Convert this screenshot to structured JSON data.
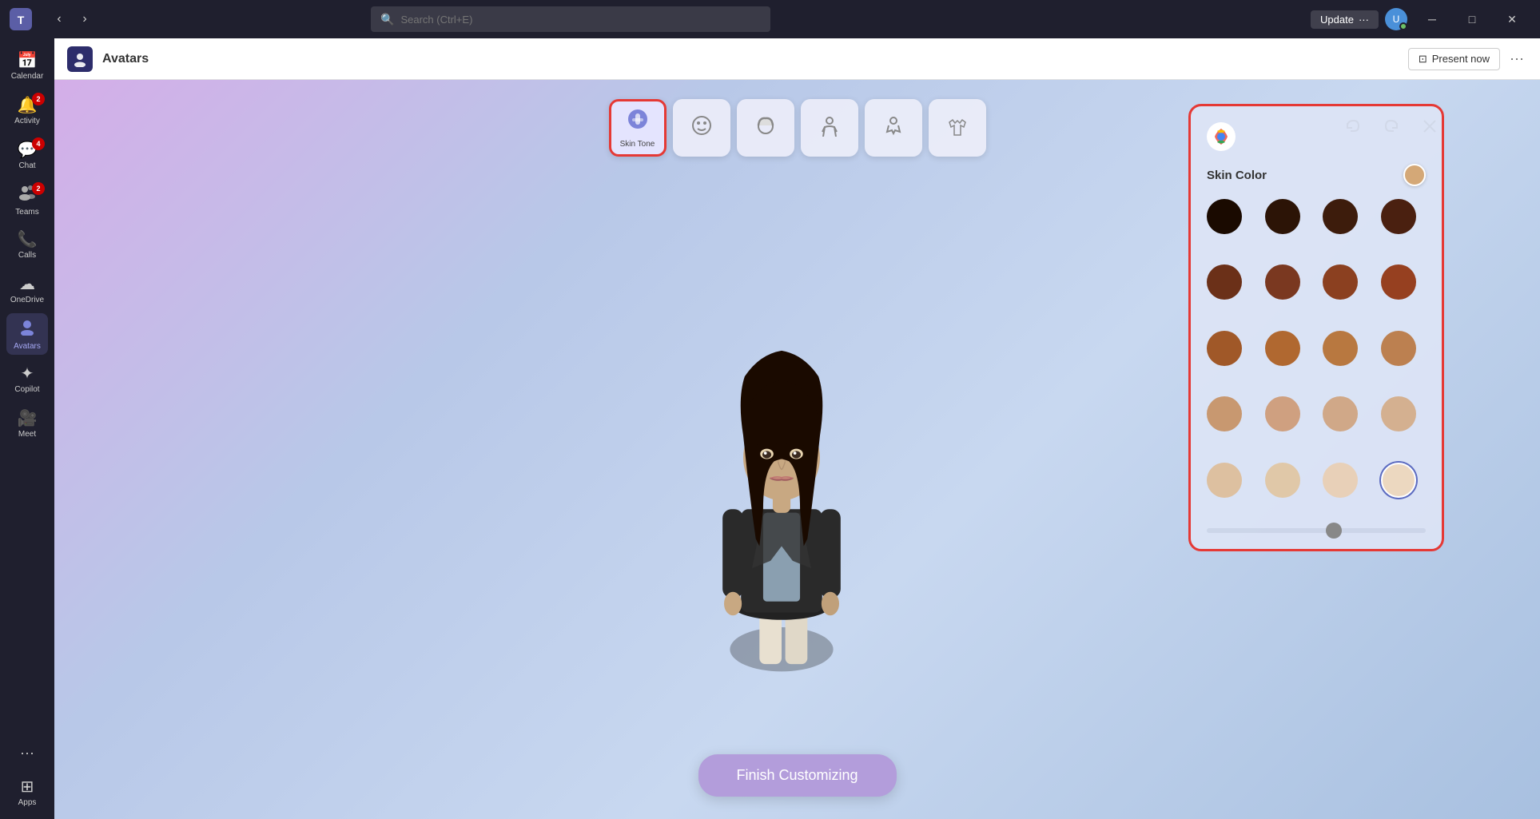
{
  "titlebar": {
    "search_placeholder": "Search (Ctrl+E)",
    "update_label": "Update",
    "update_dots": "···",
    "minimize_label": "─",
    "maximize_label": "□",
    "close_label": "✕"
  },
  "sidebar": {
    "items": [
      {
        "id": "calendar",
        "label": "Calendar",
        "icon": "📅",
        "badge": null,
        "active": false
      },
      {
        "id": "activity",
        "label": "Activity",
        "icon": "🔔",
        "badge": "2",
        "active": false
      },
      {
        "id": "chat",
        "label": "Chat",
        "icon": "💬",
        "badge": "4",
        "active": false
      },
      {
        "id": "teams",
        "label": "Teams",
        "icon": "👥",
        "badge": "2",
        "active": false
      },
      {
        "id": "calls",
        "label": "Calls",
        "icon": "📞",
        "badge": null,
        "active": false
      },
      {
        "id": "onedrive",
        "label": "OneDrive",
        "icon": "☁",
        "badge": null,
        "active": false
      },
      {
        "id": "avatars",
        "label": "Avatars",
        "icon": "🧑",
        "badge": null,
        "active": true
      },
      {
        "id": "copilot",
        "label": "Copilot",
        "icon": "⊞",
        "badge": null,
        "active": false
      },
      {
        "id": "meet",
        "label": "Meet",
        "icon": "🎥",
        "badge": null,
        "active": false
      },
      {
        "id": "apps",
        "label": "Apps",
        "icon": "⊞",
        "badge": null,
        "active": false
      }
    ],
    "more_label": "···"
  },
  "main": {
    "app_title": "Avatars",
    "present_now_label": "Present now",
    "more_dots": "···"
  },
  "editor": {
    "tools": [
      {
        "id": "skin-tone",
        "label": "Skin Tone",
        "icon": "🖌",
        "active": true
      },
      {
        "id": "face",
        "label": "",
        "icon": "😊",
        "active": false
      },
      {
        "id": "hair",
        "label": "",
        "icon": "💇",
        "active": false
      },
      {
        "id": "body",
        "label": "",
        "icon": "👤",
        "active": false
      },
      {
        "id": "accessories",
        "label": "",
        "icon": "🕺",
        "active": false
      },
      {
        "id": "clothing",
        "label": "",
        "icon": "👕",
        "active": false
      }
    ],
    "undo_label": "↩",
    "redo_label": "↪",
    "close_label": "✕",
    "finish_btn_label": "Finish Customizing"
  },
  "skin_panel": {
    "logo": "🌈",
    "title": "Skin Color",
    "current_color": "#d4a877",
    "colors": [
      "#1a0a00",
      "#2c1406",
      "#3d1c0c",
      "#4a2010",
      "#6b3018",
      "#7a3820",
      "#8b4020",
      "#964020",
      "#a05828",
      "#b06830",
      "#b87840",
      "#bc8050",
      "#c89870",
      "#cfa080",
      "#d0a888",
      "#d4b090",
      "#ddc0a0",
      "#e0c8a8",
      "#e8d0b8",
      "#ecd8c0"
    ]
  }
}
